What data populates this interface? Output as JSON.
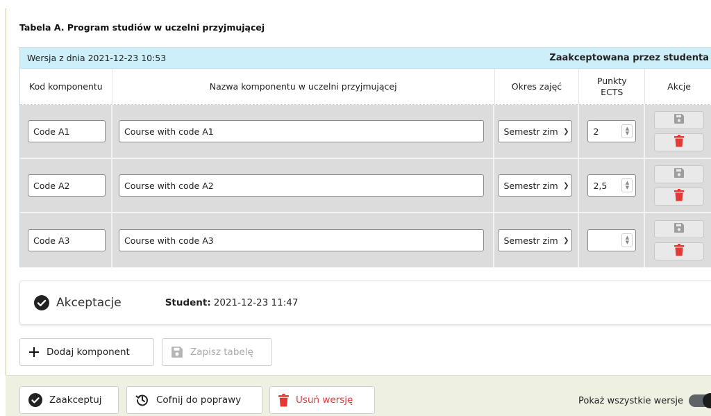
{
  "section_title": "Tabela A. Program studiów w uczelni przyjmującej",
  "version_bar": {
    "date_label": "Wersja z dnia 2021-12-23 10:53",
    "status": "Zaakceptowana przez studenta"
  },
  "columns": {
    "code": "Kod komponentu",
    "name": "Nazwa komponentu w uczelni przyjmującej",
    "period": "Okres zajęć",
    "ects_line1": "Punkty",
    "ects_line2": "ECTS",
    "actions": "Akcje"
  },
  "rows": [
    {
      "code": "Code A1",
      "name": "Course with code A1",
      "period": "Semestr zim",
      "ects": "2"
    },
    {
      "code": "Code A2",
      "name": "Course with code A2",
      "period": "Semestr zim",
      "ects": "2,5"
    },
    {
      "code": "Code A3",
      "name": "Course with code A3",
      "period": "Semestr zim",
      "ects": ""
    }
  ],
  "acceptance": {
    "title": "Akceptacje",
    "student_label": "Student:",
    "student_date": "2021-12-23 11:47"
  },
  "toolbar": {
    "add_label": "Dodaj komponent",
    "save_label": "Zapisz tabelę"
  },
  "footer": {
    "accept_label": "Zaakceptuj",
    "undo_label": "Cofnij do poprawy",
    "delete_label": "Usuń wersję",
    "toggle_label": "Pokaż wszystkie wersje",
    "toggle_on": true
  },
  "colors": {
    "version_bar_bg": "#cdeffa",
    "row_bg": "#dcdcdc",
    "danger": "#e53935",
    "footer_bg": "#eef0e2"
  },
  "icons": {
    "save": "floppy-disk-icon",
    "delete": "trash-icon",
    "add": "plus-icon",
    "accept": "check-circle-icon",
    "undo": "history-icon"
  }
}
